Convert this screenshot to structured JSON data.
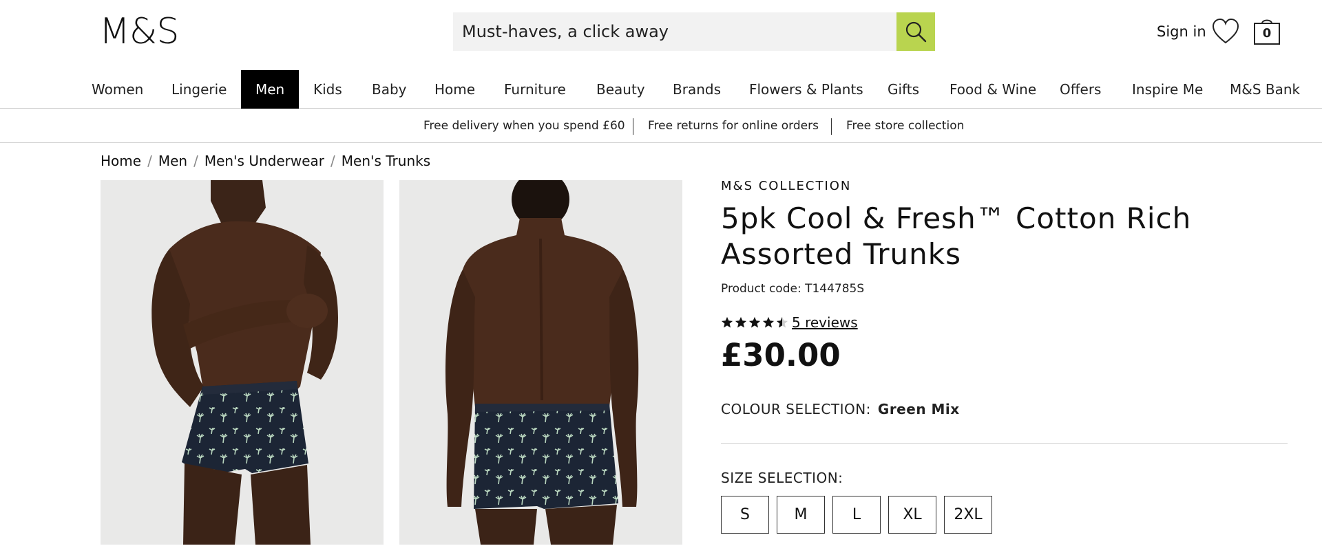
{
  "header": {
    "logo": "M&S",
    "search_placeholder": "Must-haves, a click away",
    "sign_in": "Sign in",
    "bag_count": "0",
    "accent_color": "#b9d44f"
  },
  "nav": {
    "items": [
      "Women",
      "Lingerie",
      "Men",
      "Kids",
      "Baby",
      "Home",
      "Furniture",
      "Beauty",
      "Brands",
      "Flowers & Plants",
      "Gifts",
      "Food & Wine",
      "Offers",
      "Inspire Me",
      "M&S Bank"
    ],
    "active": "Men"
  },
  "promo": {
    "items": [
      "Free delivery when you spend £60",
      "Free returns for online orders",
      "Free store collection"
    ]
  },
  "breadcrumb": [
    "Home",
    "Men",
    "Men's Underwear",
    "Men's Trunks"
  ],
  "product": {
    "brand": "M&S COLLECTION",
    "title": "5pk Cool & Fresh™ Cotton Rich Assorted Trunks",
    "code": "Product code: T144785S",
    "rating": 4.5,
    "rating_max": 5,
    "reviews": "5 reviews",
    "price": "£30.00",
    "colour_label": "COLOUR SELECTION:",
    "colour_value": "Green Mix",
    "size_label": "SIZE SELECTION:",
    "sizes": [
      "S",
      "M",
      "L",
      "XL",
      "2XL"
    ]
  }
}
